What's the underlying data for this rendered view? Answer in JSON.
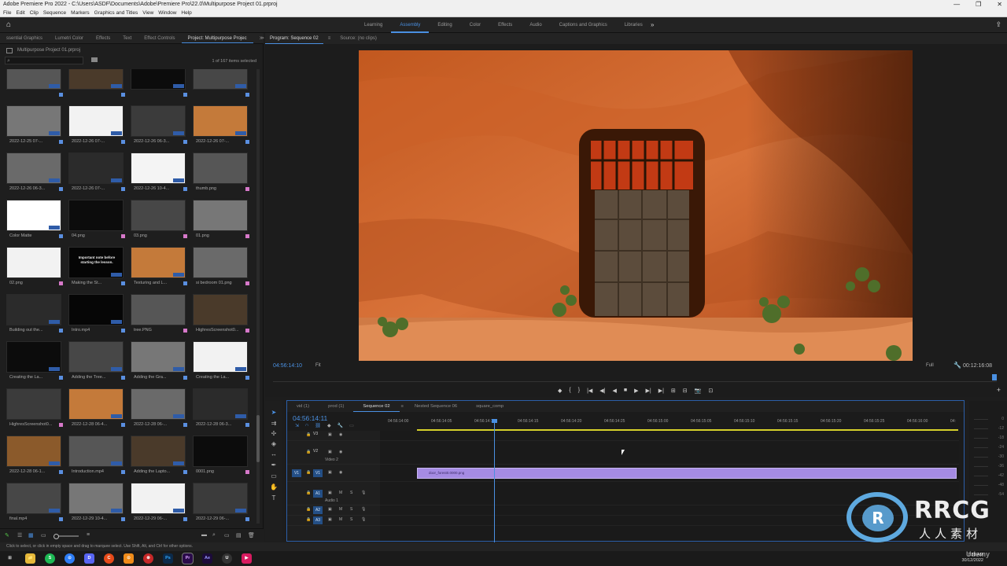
{
  "window": {
    "title": "Adobe Premiere Pro 2022 - C:\\Users\\ASDF\\Documents\\Adobe\\Premiere Pro\\22.0\\Multipurpose Project 01.prproj",
    "controls": [
      "—",
      "❐",
      "✕"
    ]
  },
  "menu": [
    "File",
    "Edit",
    "Clip",
    "Sequence",
    "Markers",
    "Graphics and Titles",
    "View",
    "Window",
    "Help"
  ],
  "workspaces": {
    "tabs": [
      "Learning",
      "Assembly",
      "Editing",
      "Color",
      "Effects",
      "Audio",
      "Captions and Graphics",
      "Libraries"
    ],
    "active": "Assembly",
    "more": "»"
  },
  "left_panel": {
    "tabs": [
      "ssential Graphics",
      "Lumetri Color",
      "Effects",
      "Text",
      "Effect Controls",
      "Project: Multipurpose Projec",
      "≫"
    ],
    "active_tab": "Project: Multipurpose Projec",
    "project_file": "Multipurpose Project 01.prproj",
    "search_placeholder": "",
    "items_selected": "1 of 167 items selected",
    "items": [
      {
        "label": "",
        "chip": "#5a8fe0"
      },
      {
        "label": "",
        "chip": "#5a8fe0"
      },
      {
        "label": "",
        "chip": "#5a8fe0"
      },
      {
        "label": "",
        "chip": "#5a8fe0"
      },
      {
        "label": "2022-12-25 07-...",
        "chip": "#5a8fe0"
      },
      {
        "label": "2022-12-26 07-...",
        "chip": "#5a8fe0"
      },
      {
        "label": "2022-12-26 06-3...",
        "chip": "#5a8fe0"
      },
      {
        "label": "2022-12-26 07-...",
        "chip": "#5a8fe0"
      },
      {
        "label": "2022-12-26 06-3...",
        "chip": "#5a8fe0"
      },
      {
        "label": "2022-12-26 07-...",
        "chip": "#5a8fe0"
      },
      {
        "label": "2022-12-26 10-4...",
        "chip": "#5a8fe0"
      },
      {
        "label": "thumb.png",
        "chip": "#d678c9"
      },
      {
        "label": "Color Matte",
        "chip": "#5a8fe0"
      },
      {
        "label": "04.png",
        "chip": "#d678c9"
      },
      {
        "label": "03.png",
        "chip": "#d678c9"
      },
      {
        "label": "01.png",
        "chip": "#d678c9"
      },
      {
        "label": "02.png",
        "chip": "#d678c9"
      },
      {
        "label": "Making the St...",
        "chip": "#5a8fe0"
      },
      {
        "label": "Texturing and L...",
        "chip": "#5a8fe0"
      },
      {
        "label": "si bedroom 01.png",
        "chip": "#d678c9"
      },
      {
        "label": "Building out the...",
        "chip": "#5a8fe0"
      },
      {
        "label": "Intro.mp4",
        "chip": "#5a8fe0"
      },
      {
        "label": "tree.PNG",
        "chip": "#d678c9"
      },
      {
        "label": "HighresScreenshot0...",
        "chip": "#d678c9"
      },
      {
        "label": "Creating the La...",
        "chip": "#5a8fe0"
      },
      {
        "label": "Adding the Tree...",
        "chip": "#5a8fe0"
      },
      {
        "label": "Adding the Gra...",
        "chip": "#5a8fe0"
      },
      {
        "label": "Creating the La...",
        "chip": "#5a8fe0"
      },
      {
        "label": "HighresScreenshot0...",
        "chip": "#d678c9"
      },
      {
        "label": "2022-12-28 06-4...",
        "chip": "#5a8fe0"
      },
      {
        "label": "2022-12-28 06-...",
        "chip": "#5a8fe0"
      },
      {
        "label": "2022-12-28 06-3...",
        "chip": "#5a8fe0"
      },
      {
        "label": "2022-12-28 06-1...",
        "chip": "#5a8fe0"
      },
      {
        "label": "Introduction.mp4",
        "chip": "#5a8fe0"
      },
      {
        "label": "Adding the Lapto...",
        "chip": "#5a8fe0"
      },
      {
        "label": "0001.png",
        "chip": "#d678c9"
      },
      {
        "label": "final.mp4",
        "chip": "#5a8fe0"
      },
      {
        "label": "2022-12-29 10-4...",
        "chip": "#5a8fe0"
      },
      {
        "label": "2022-12-29 06-...",
        "chip": "#5a8fe0"
      },
      {
        "label": "2022-12-29 06-...",
        "chip": "#5a8fe0"
      },
      {
        "label": "2022-12-29 06-...",
        "chip": "#5a8fe0"
      },
      {
        "label": "2022-12-29 06-3...",
        "chip": "#5a8fe0"
      },
      {
        "label": "door_forest0.0000...",
        "chip": "#b07ce0"
      }
    ],
    "thumbnail_text": "Important note before starting the lesson.",
    "selected_item": "door_forest0.0000..."
  },
  "program_monitor": {
    "tabs": [
      "Program: Sequence 02",
      "≡",
      "Source: (no clips)"
    ],
    "active_tab": "Program: Sequence 02",
    "timecode": "04:56:14:10",
    "fit": "Fit",
    "resolution": "Full",
    "duration": "00:12:16:08",
    "controls": [
      "◆",
      "{",
      "}",
      "|◀",
      "◀|",
      "◀",
      "■",
      "▶",
      "▶|",
      "▶|",
      "⊞",
      "⊟",
      "📷",
      "⊡"
    ],
    "add_button": "+"
  },
  "timeline": {
    "tabs": [
      "vid (1)",
      "prod (1)",
      "Sequence 02",
      "≡",
      "Nested Sequence 06",
      "square_comp"
    ],
    "active_tab": "Sequence 02",
    "timecode": "04:56:14:11",
    "ruler": [
      "04:56:14:00",
      "04:56:14:05",
      "04:56:14:10",
      "04:56:14:15",
      "04:56:14:20",
      "04:56:14:25",
      "04:56:15:00",
      "04:56:15:05",
      "04:56:15:10",
      "04:56:15:15",
      "04:56:15:20",
      "04:56:15:25",
      "04:56:16:00",
      "04:"
    ],
    "tracks": [
      {
        "id": "V3",
        "name": ""
      },
      {
        "id": "V2",
        "name": "Video 2"
      },
      {
        "id": "V1",
        "name": "",
        "target": "V1"
      },
      {
        "id": "A1",
        "name": "Audio 1"
      },
      {
        "id": "A2",
        "name": ""
      },
      {
        "id": "A3",
        "name": ""
      }
    ],
    "clip": {
      "name": "door_forest0.0000.png",
      "color": "#a58be3"
    },
    "track_buttons": [
      "M",
      "S",
      "🎙"
    ]
  },
  "meters": {
    "ticks": [
      "0",
      "-12",
      "-18",
      "-24",
      "-30",
      "-36",
      "-42",
      "-48",
      "-54"
    ]
  },
  "status": {
    "hint": "Click to select, or click in empty space and drag to marquee select. Use Shift, Alt, and Ctrl for other options."
  },
  "taskbar": {
    "apps": [
      "⊞",
      "📁",
      "S",
      "⊙",
      "D",
      "C",
      "⊙",
      "⊛",
      "Ps",
      "Pr",
      "Ae",
      "U",
      "▶"
    ],
    "time": "7:38 AM",
    "date": "30/12/2022"
  },
  "watermark": {
    "brand": "RRCG",
    "cn": "人人素材",
    "logo": "R",
    "udemy": "Udemy"
  }
}
